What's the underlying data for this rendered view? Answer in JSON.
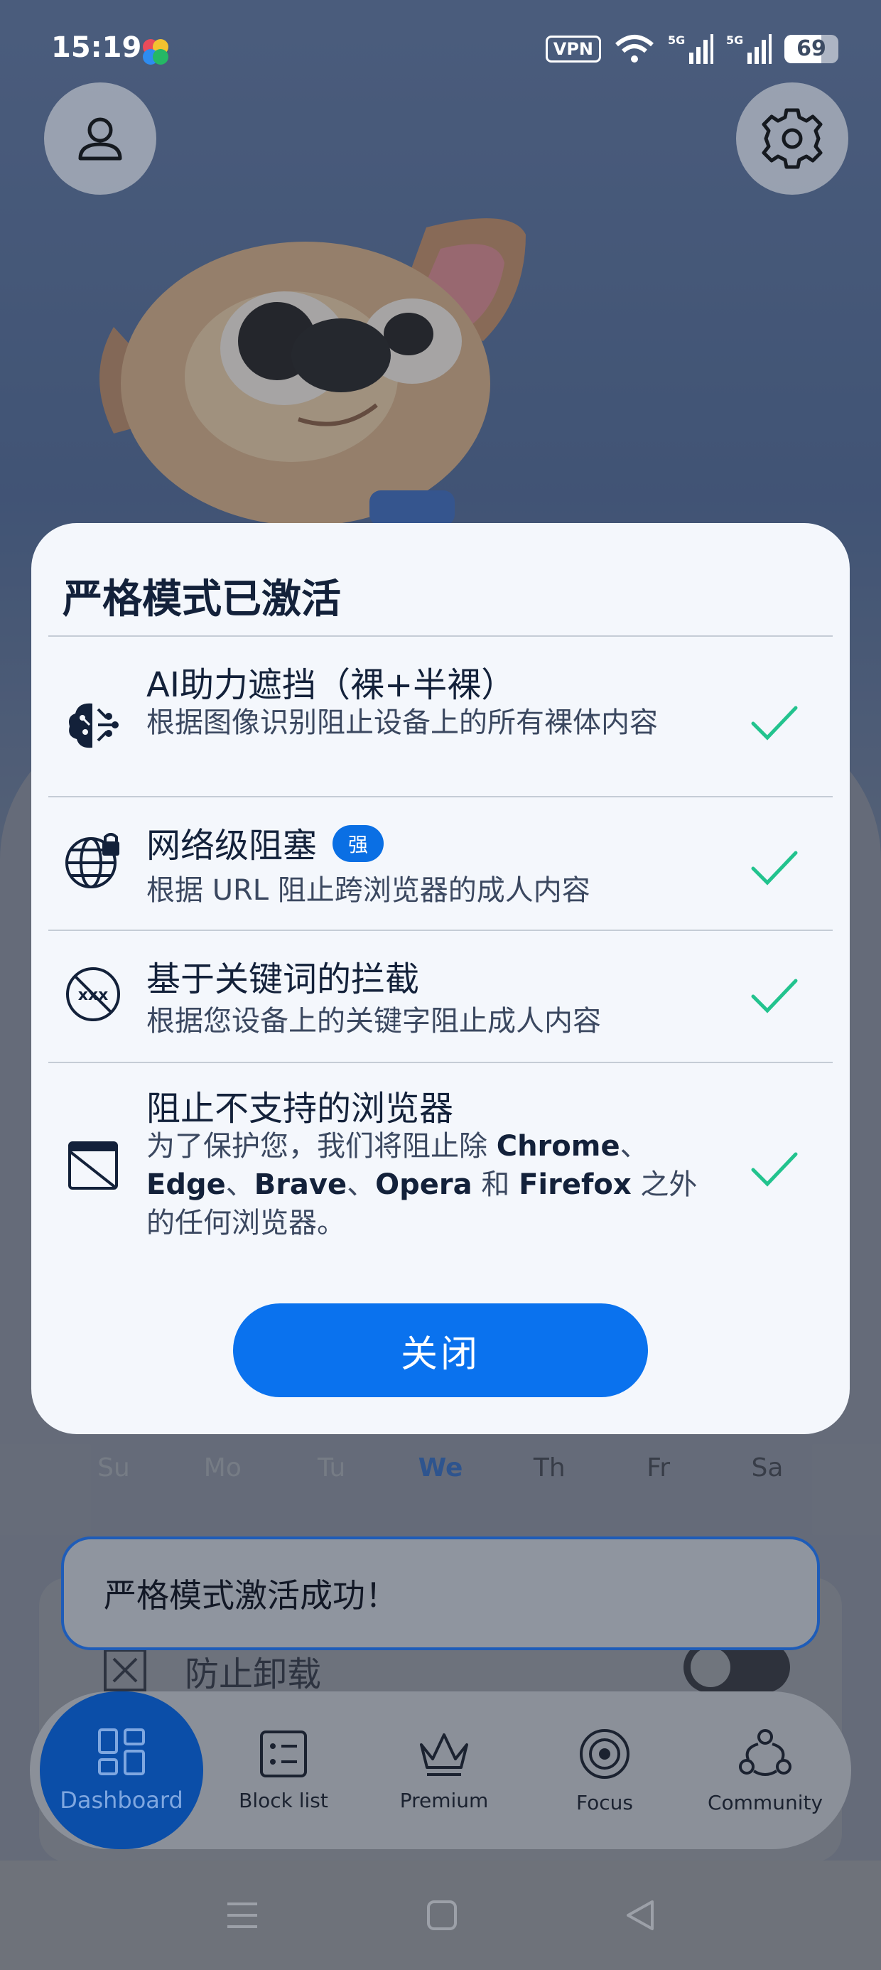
{
  "status_bar": {
    "time": "15:19",
    "vpn": "VPN",
    "network": "5G",
    "battery": "69"
  },
  "modal": {
    "title": "严格模式已激活",
    "features": [
      {
        "icon": "ai-brain-icon",
        "title": "AI助力遮挡（裸+半裸）",
        "description": "根据图像识别阻止设备上的所有裸体内容"
      },
      {
        "icon": "globe-lock-icon",
        "title": "网络级阻塞",
        "badge": "强",
        "description": "根据 URL 阻止跨浏览器的成人内容"
      },
      {
        "icon": "xxx-blocked-icon",
        "title": "基于关键词的拦截",
        "description": "根据您设备上的关键字阻止成人内容"
      },
      {
        "icon": "browser-blocked-icon",
        "title": "阻止不支持的浏览器",
        "description_parts": [
          "为了保护您，我们将阻止除 ",
          "Chrome",
          "、",
          "Edge",
          "、",
          "Brave",
          "、",
          "Opera",
          " 和 ",
          "Firefox",
          " 之外的任何浏览器。"
        ]
      }
    ],
    "close_label": "关闭"
  },
  "calendar": {
    "days": [
      "Su",
      "Mo",
      "Tu",
      "We",
      "Th",
      "Fr",
      "Sa"
    ],
    "today": "We"
  },
  "toast": {
    "message": "严格模式激活成功！"
  },
  "background_setting": {
    "label": "防止卸载"
  },
  "bottom_nav": {
    "items": [
      {
        "label": "Dashboard",
        "icon": "dashboard-icon",
        "active": true
      },
      {
        "label": "Block list",
        "icon": "block-list-icon"
      },
      {
        "label": "Premium",
        "icon": "crown-icon"
      },
      {
        "label": "Focus",
        "icon": "focus-icon"
      },
      {
        "label": "Community",
        "icon": "community-icon"
      }
    ]
  },
  "colors": {
    "accent": "#0a72ee",
    "check": "#22c38e",
    "nav_active": "#0b4ea8"
  }
}
